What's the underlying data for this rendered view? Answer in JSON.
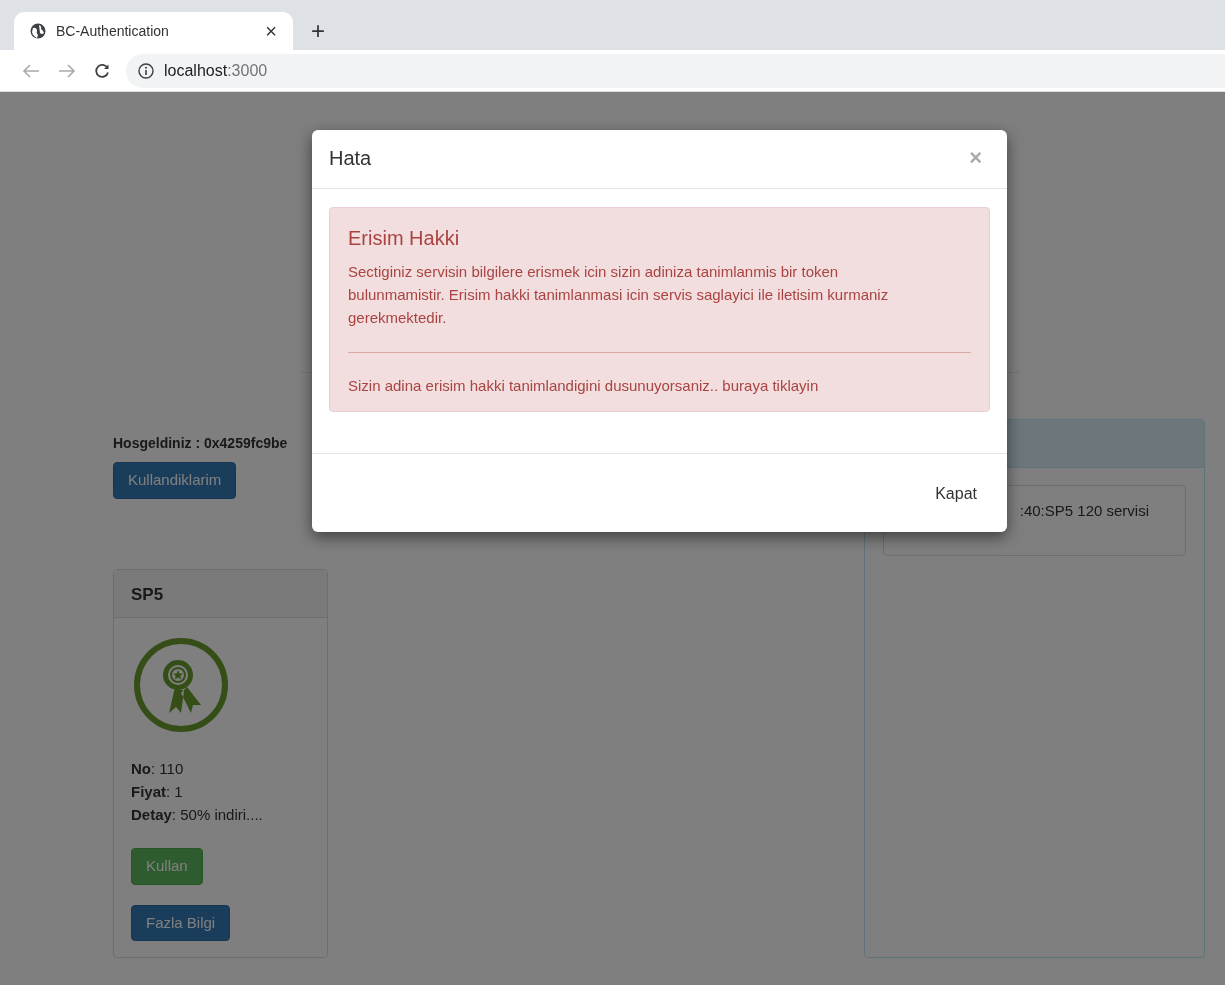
{
  "browser": {
    "tab_title": "BC-Authentication",
    "tab_close": "×",
    "new_tab": "+",
    "url_host": "localhost",
    "url_port": ":3000"
  },
  "page": {
    "welcome": "Hosgeldiniz : 0x4259fc9be",
    "history_button": "Kullandiklarim",
    "service_cards": [
      {
        "title": "SP5",
        "details": [
          "**No**: 110",
          "**Fiyat**: 1",
          "**Detay**: 50% indiri...."
        ],
        "buttons": [
          {
            "kind": "success",
            "label": "Kullan"
          },
          {
            "kind": "primary",
            "label": "Fazla Bilgi"
          }
        ]
      }
    ],
    "panel": {
      "items": [
        ":40:SP5 120 servisi"
      ]
    }
  },
  "modal": {
    "title": "Hata",
    "close": "×",
    "alert": {
      "heading": "Erisim Hakki",
      "message": "Sectiginiz servisin bilgilere erismek icin sizin adiniza tanimlanmis bir token bulunmamistir. Erisim hakki tanimlanmasi icin servis saglayici ile iletisim kurmaniz gerekmektedir.",
      "footer_text": "Sizin adina erisim hakki tanimlandigini dusunuyorsaniz.. buraya tiklayin"
    },
    "footer_button": "Kapat"
  }
}
